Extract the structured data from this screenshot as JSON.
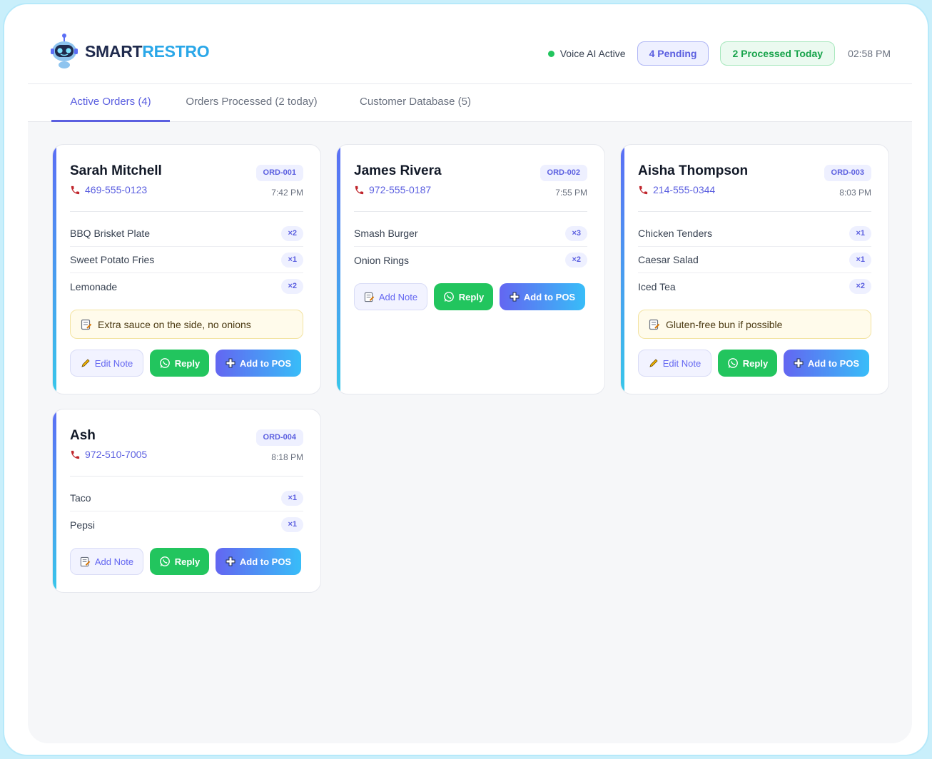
{
  "brand": {
    "part1": "SMART",
    "part2": "RESTRO"
  },
  "header": {
    "voice_status": "Voice AI Active",
    "pending": "4 Pending",
    "processed": "2 Processed Today",
    "clock": "02:58 PM"
  },
  "tabs": [
    {
      "label": "Active Orders (4)",
      "active": true
    },
    {
      "label": "Orders Processed (2 today)",
      "active": false
    },
    {
      "label": "Customer Database (5)",
      "active": false
    }
  ],
  "orders": [
    {
      "name": "Sarah Mitchell",
      "phone": "469-555-0123",
      "id": "ORD-001",
      "time": "7:42 PM",
      "items": [
        {
          "name": "BBQ Brisket Plate",
          "qty": "×2"
        },
        {
          "name": "Sweet Potato Fries",
          "qty": "×1"
        },
        {
          "name": "Lemonade",
          "qty": "×2"
        }
      ],
      "note": "Extra sauce on the side, no onions",
      "note_button": "Edit Note",
      "reply": "Reply",
      "pos": "Add to POS"
    },
    {
      "name": "James Rivera",
      "phone": "972-555-0187",
      "id": "ORD-002",
      "time": "7:55 PM",
      "items": [
        {
          "name": "Smash Burger",
          "qty": "×3"
        },
        {
          "name": "Onion Rings",
          "qty": "×2"
        }
      ],
      "note_button": "Add Note",
      "reply": "Reply",
      "pos": "Add to POS"
    },
    {
      "name": "Aisha Thompson",
      "phone": "214-555-0344",
      "id": "ORD-003",
      "time": "8:03 PM",
      "items": [
        {
          "name": "Chicken Tenders",
          "qty": "×1"
        },
        {
          "name": "Caesar Salad",
          "qty": "×1"
        },
        {
          "name": "Iced Tea",
          "qty": "×2"
        }
      ],
      "note": "Gluten-free bun if possible",
      "note_button": "Edit Note",
      "reply": "Reply",
      "pos": "Add to POS"
    },
    {
      "name": "Ash",
      "phone": "972-510-7005",
      "id": "ORD-004",
      "time": "8:18 PM",
      "items": [
        {
          "name": "Taco",
          "qty": "×1"
        },
        {
          "name": "Pepsi",
          "qty": "×1"
        }
      ],
      "note_button": "Add Note",
      "reply": "Reply",
      "pos": "Add to POS"
    }
  ],
  "icons": {
    "logo": "robot-logo-icon",
    "status": "status-dot-icon",
    "phone": "phone-icon",
    "note": "note-icon",
    "edit": "pencil-icon",
    "whatsapp": "whatsapp-icon",
    "add": "plus-icon"
  },
  "colors": {
    "accent": "#5b5fe0",
    "reply_green": "#22c55e",
    "pos_gradient_start": "#6366f1",
    "pos_gradient_end": "#38bdf8",
    "note_bg": "#fffbeb"
  }
}
